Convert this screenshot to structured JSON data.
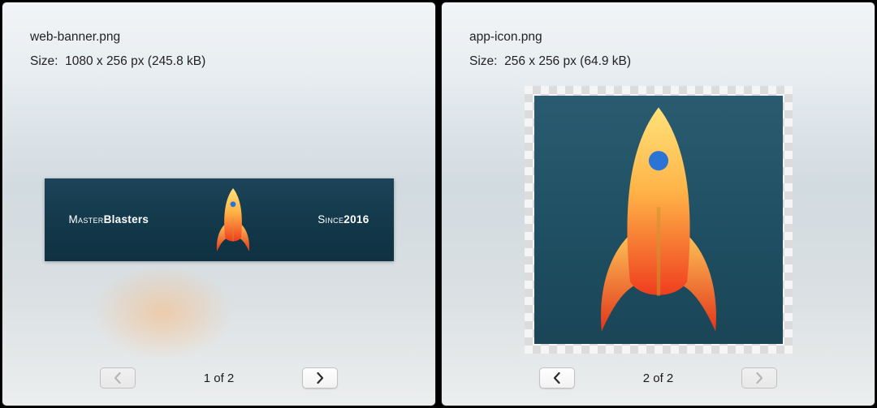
{
  "panels": [
    {
      "filename": "web-banner.png",
      "size_label": "Size:",
      "size_value": "1080 x 256 px (245.8 kB)",
      "pager_text": "1 of 2",
      "prev_enabled": false,
      "next_enabled": true,
      "image_kind": "banner",
      "banner": {
        "left_light": "Master",
        "left_bold": "Blasters",
        "right_light": "Since",
        "right_bold": "2016"
      }
    },
    {
      "filename": "app-icon.png",
      "size_label": "Size:",
      "size_value": "256 x 256 px (64.9 kB)",
      "pager_text": "2 of 2",
      "prev_enabled": true,
      "next_enabled": false,
      "image_kind": "icon"
    }
  ],
  "icons": {
    "chevron_left": "chevron-left-icon",
    "chevron_right": "chevron-right-icon",
    "rocket": "rocket-icon"
  },
  "colors": {
    "teal_dark": "#13394b",
    "teal_icon": "#225265",
    "rocket_top": "#ffe27a",
    "rocket_bottom": "#ef3e1f",
    "porthole": "#2b74d6"
  }
}
